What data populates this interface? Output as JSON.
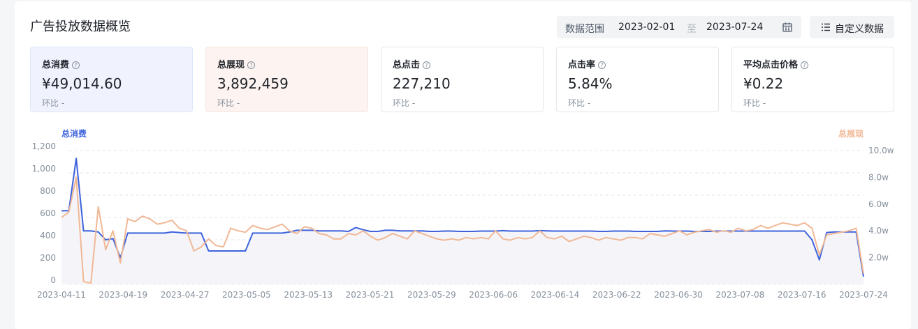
{
  "header": {
    "title": "广告投放数据概览",
    "range_label": "数据范围",
    "start_date": "2023-02-01",
    "separator": "至",
    "end_date": "2023-07-24",
    "custom_button": "自定义数据"
  },
  "kpis": [
    {
      "name": "总消费",
      "value": "¥49,014.60",
      "compare": "环比 -",
      "help": "?"
    },
    {
      "name": "总展现",
      "value": "3,892,459",
      "compare": "环比 -",
      "help": "?"
    },
    {
      "name": "总点击",
      "value": "227,210",
      "compare": "环比 -",
      "help": "?"
    },
    {
      "name": "点击率",
      "value": "5.84%",
      "compare": "环比 -",
      "help": "?"
    },
    {
      "name": "平均点击价格",
      "value": "¥0.22",
      "compare": "环比 -",
      "help": "?"
    }
  ],
  "colors": {
    "spend": "#3d63dd",
    "impressions": "#f0b896",
    "grid": "#e5e6eb"
  },
  "chart_data": {
    "type": "line",
    "legend_left": "总消费",
    "legend_right": "总展现",
    "y_left_ticks": [
      "1,200",
      "1,000",
      "800",
      "600",
      "400",
      "200",
      "0"
    ],
    "y_right_ticks": [
      "10.0w",
      "8.0w",
      "6.0w",
      "4.0w",
      "2.0w"
    ],
    "ylim_left": [
      0,
      1200
    ],
    "ylim_right": [
      0,
      100000
    ],
    "x_ticks": [
      "2023-04-11",
      "2023-04-19",
      "2023-04-27",
      "2023-05-05",
      "2023-05-13",
      "2023-05-21",
      "2023-05-29",
      "2023-06-06",
      "2023-06-14",
      "2023-06-22",
      "2023-06-30",
      "2023-07-08",
      "2023-07-16",
      "2023-07-24"
    ],
    "x_start": "2023-04-11",
    "x_end": "2023-07-24",
    "series": [
      {
        "name": "总消费",
        "axis": "left",
        "values": [
          660,
          660,
          1130,
          480,
          480,
          470,
          400,
          410,
          240,
          460,
          460,
          460,
          460,
          460,
          460,
          470,
          465,
          460,
          460,
          460,
          300,
          300,
          300,
          300,
          300,
          300,
          460,
          460,
          460,
          460,
          460,
          470,
          485,
          485,
          485,
          480,
          480,
          480,
          480,
          475,
          510,
          490,
          475,
          475,
          485,
          485,
          480,
          480,
          480,
          480,
          475,
          475,
          478,
          478,
          475,
          475,
          475,
          478,
          478,
          478,
          482,
          478,
          478,
          478,
          478,
          482,
          480,
          478,
          478,
          478,
          478,
          478,
          478,
          475,
          475,
          478,
          478,
          478,
          475,
          475,
          475,
          475,
          480,
          478,
          478,
          478,
          475,
          475,
          475,
          478,
          478,
          478,
          478,
          478,
          478,
          478,
          478,
          478,
          478,
          478,
          478,
          478,
          400,
          220,
          465,
          470,
          470,
          470,
          470,
          70
        ]
      },
      {
        "name": "总展现",
        "axis": "right",
        "values": [
          50000,
          54000,
          80000,
          2000,
          1000,
          58000,
          26000,
          40000,
          16000,
          49000,
          47000,
          51000,
          49000,
          45000,
          46000,
          48000,
          42000,
          40000,
          25000,
          28000,
          34000,
          29000,
          28000,
          42000,
          40000,
          39000,
          44000,
          42000,
          41000,
          43000,
          45000,
          40000,
          38000,
          43000,
          42000,
          38000,
          37000,
          34000,
          34000,
          38000,
          37000,
          40000,
          36000,
          33000,
          35000,
          38000,
          36000,
          34000,
          40000,
          38000,
          36000,
          34000,
          33000,
          34000,
          33000,
          35000,
          34000,
          35000,
          34000,
          40000,
          34000,
          33000,
          35000,
          34000,
          35000,
          40000,
          35000,
          34000,
          36000,
          32000,
          34000,
          36000,
          35000,
          33000,
          35000,
          34000,
          33000,
          35000,
          35000,
          34000,
          38000,
          37000,
          36000,
          38000,
          40000,
          37000,
          39000,
          40000,
          41000,
          39000,
          40000,
          39000,
          42000,
          40000,
          41000,
          44000,
          42000,
          44000,
          46000,
          45000,
          44000,
          46000,
          42000,
          22000,
          37000,
          38000,
          39000,
          40000,
          42000,
          8000
        ]
      }
    ]
  }
}
